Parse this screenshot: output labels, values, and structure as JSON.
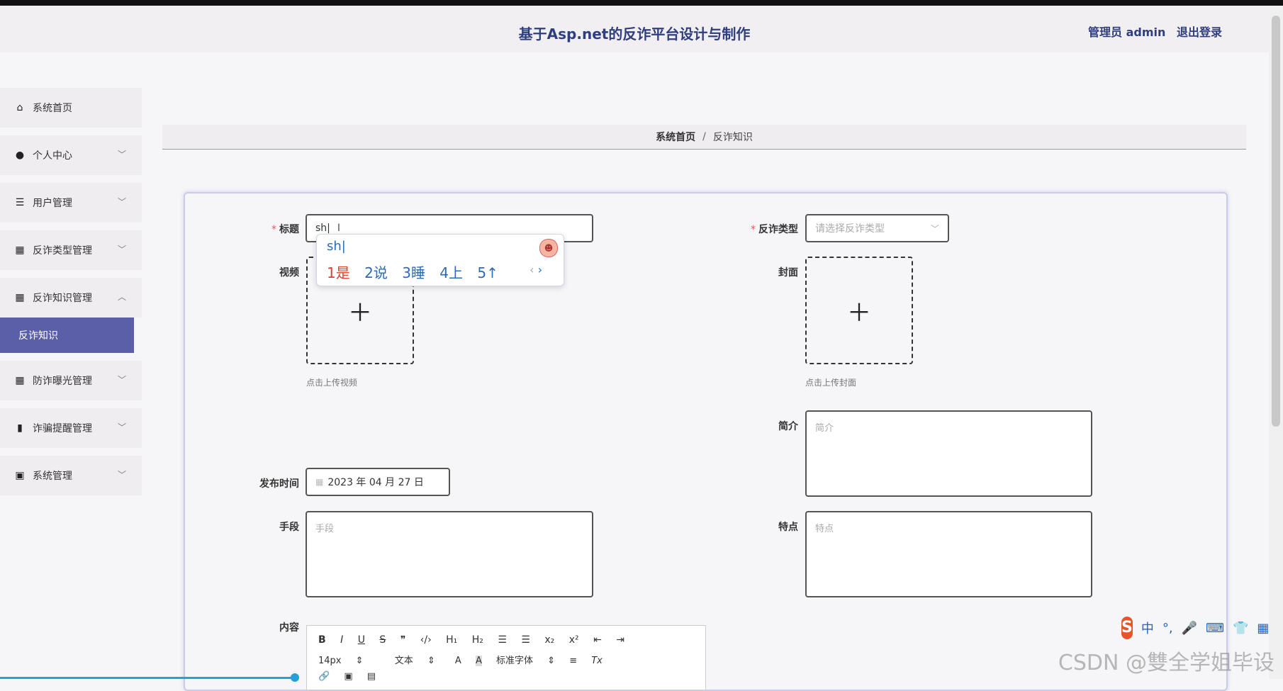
{
  "header": {
    "title": "基于Asp.net的反诈平台设计与制作",
    "role": "管理员 admin",
    "logout": "退出登录"
  },
  "sidebar": {
    "items": [
      {
        "label": "系统首页",
        "icon": "home-icon",
        "glyph": "⌂"
      },
      {
        "label": "个人中心",
        "icon": "user-icon",
        "glyph": "●"
      },
      {
        "label": "用户管理",
        "icon": "list-icon",
        "glyph": "☰"
      },
      {
        "label": "反诈类型管理",
        "icon": "grid-icon",
        "glyph": "▦"
      },
      {
        "label": "反诈知识管理",
        "icon": "grid-icon",
        "glyph": "▦"
      },
      {
        "label": "防诈曝光管理",
        "icon": "grid-icon",
        "glyph": "▦"
      },
      {
        "label": "诈骗提醒管理",
        "icon": "bar-chart-icon",
        "glyph": "▮"
      },
      {
        "label": "系统管理",
        "icon": "clipboard-icon",
        "glyph": "▣"
      }
    ],
    "sub_active": "反诈知识"
  },
  "breadcrumb": {
    "home": "系统首页",
    "separator": "/",
    "current": "反诈知识"
  },
  "form": {
    "title_label": "标题",
    "title_value": "sh",
    "type_label": "反诈类型",
    "type_placeholder": "请选择反诈类型",
    "video_label": "视频",
    "video_hint": "点击上传视频",
    "cover_label": "封面",
    "cover_hint": "点击上传封面",
    "intro_label": "简介",
    "intro_placeholder": "简介",
    "date_label": "发布时间",
    "date_value": "2023 年 04 月 27 日",
    "method_label": "手段",
    "method_placeholder": "手段",
    "feature_label": "特点",
    "feature_placeholder": "特点",
    "content_label": "内容"
  },
  "ime": {
    "input": "sh",
    "candidates": [
      "1是",
      "2说",
      "3睡",
      "4上",
      "5↑"
    ]
  },
  "editor": {
    "row1": [
      "B",
      "I",
      "U",
      "S",
      "❞",
      "‹/›",
      "H₁",
      "H₂",
      "☰",
      "☰",
      "x₂",
      "x²",
      "⇤",
      "⇥"
    ],
    "row2": [
      "14px",
      "⇕",
      "文本",
      "⇕",
      "A",
      "A",
      "标准字体",
      "⇕",
      "≡",
      "Tx"
    ],
    "row3": [
      "🔗",
      "▣",
      "▤"
    ]
  },
  "ime_toolbar": [
    "S",
    "中",
    "°,",
    "🎤",
    "⌨",
    "👕",
    "▦"
  ],
  "watermark": "CSDN @雙全学姐毕设"
}
